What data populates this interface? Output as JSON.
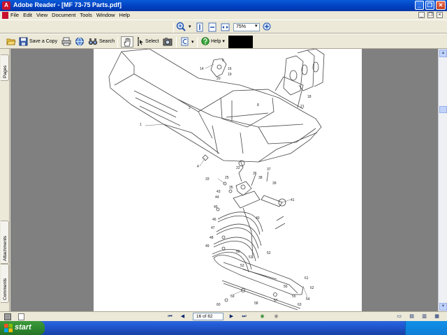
{
  "window": {
    "title": "Adobe Reader - [MF 73-75 Parts.pdf]"
  },
  "menu": {
    "items": [
      "File",
      "Edit",
      "View",
      "Document",
      "Tools",
      "Window",
      "Help"
    ]
  },
  "toolbar": {
    "zoom_value": "75%",
    "save_copy_label": "Save a Copy",
    "search_label": "Search",
    "select_label": "Select",
    "help_label": "Help"
  },
  "navtabs": {
    "pages": "Pages",
    "attachments": "Attachments",
    "comments": "Comments"
  },
  "status": {
    "page_indicator": "16 of 82"
  },
  "taskbar": {
    "start_label": "start"
  },
  "drawing": {
    "callouts": [
      "1",
      "2",
      "4",
      "6",
      "8",
      "14",
      "16",
      "18",
      "19",
      "20",
      "21",
      "22",
      "25",
      "32",
      "33",
      "35",
      "36",
      "37",
      "38",
      "39",
      "40",
      "41",
      "43",
      "44",
      "45",
      "46",
      "47",
      "48",
      "49",
      "50",
      "51",
      "52",
      "53",
      "54",
      "55",
      "56",
      "57",
      "58",
      "59",
      "60",
      "61",
      "62",
      "63"
    ]
  }
}
